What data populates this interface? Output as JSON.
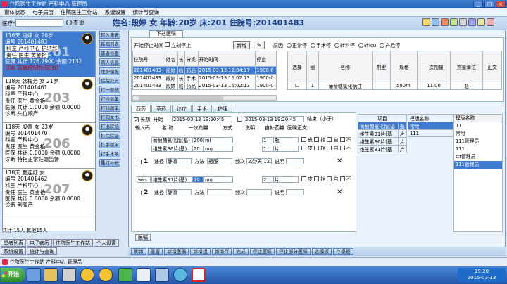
{
  "window": {
    "title": "住院医生工作站  产科中心  管理员"
  },
  "menu": [
    "窗体状态",
    "电子病历",
    "住院医生工作站",
    "系统设置",
    "统计与查询"
  ],
  "toolbar": {
    "card_label": "医疗卡",
    "query_label": "查询"
  },
  "patient_header": "姓名:段婷  女  年龄:20岁  床:201  住院号:201401483",
  "patients": [
    {
      "rows": [
        "116天  段婷   女  20岁",
        "编号  201401483",
        "科室  产科中心  护理部",
        "责任  医生  黄金艳",
        "医保  共计 176.7900 余额 2132",
        "诊断  疾病控制住院治疗"
      ],
      "bed": "201",
      "selected": true
    },
    {
      "rows": [
        "118天  张梅芳  女  21岁",
        "编号  201401461",
        "科室  产科中心",
        "责任  医生  黄金艳",
        "医保  共计 0.0000 余额 0.0000",
        "诊断  头位顺产"
      ],
      "bed": "203",
      "selected": false
    },
    {
      "rows": [
        "118天  殷佩  女  23岁",
        "编号  201401470",
        "科室  产科中心",
        "责任  医生  黄金艳",
        "医保  共计 0.0000 余额 0.0000",
        "诊断  特指正常妊娠监督"
      ],
      "bed": "206",
      "selected": false
    },
    {
      "rows": [
        "118天  夏连红  女",
        "编号  201401462",
        "科室  产科中心",
        "责任  医生  黄金艳",
        "医保  共计 0.0000 余额 0.0000",
        "诊断  剖腹产"
      ],
      "bed": "207",
      "selected": false
    }
  ],
  "left_status": "共计:15人  其他15人",
  "left_buttons": [
    "患者列表",
    "电子病历",
    "住院医生工作站",
    "个人设置",
    "系统设置",
    "统计与查询"
  ],
  "side_buttons": [
    "转入患者",
    "新病列表",
    "患者检查",
    "病人信息",
    "维护模板",
    "住院处方",
    "打一般核",
    "打检验单",
    "打钱超单",
    "打病文书",
    "打出院结",
    "打住院证",
    "打手续单",
    "打手术单",
    "重打补帐"
  ],
  "top_tab": "下达医嘱",
  "controls": {
    "stop_time_label": "开始停止时间",
    "immediate_stop_label": "立刻停止",
    "new_label": "新增",
    "edit_label": "✎"
  },
  "radios": [
    "原因",
    "正常停",
    "手术停",
    "转科停",
    "转icu",
    "产后停"
  ],
  "order_table": {
    "headers": [
      "住院号",
      "姓名",
      "长",
      "分类",
      "开始时间",
      "停止"
    ],
    "rows": [
      [
        "201401483",
        "段婷",
        "临",
        "药品",
        "2015-03-13 12:04:17",
        "1900-0"
      ],
      [
        "201401483",
        "段婷",
        "长",
        "手术",
        "2015-03-13 16:02:13",
        "1900-0"
      ],
      [
        "201401483",
        "段婷",
        "临",
        "药品",
        "2015-03-13 16:02:13",
        "1900-0"
      ]
    ]
  },
  "drug_table": {
    "headers": [
      "选择",
      "组",
      "名称",
      "剂型",
      "规格",
      "一次剂量",
      "剂量单位",
      "正文"
    ],
    "rows": [
      [
        "☐",
        "1",
        "葡萄糖氯化钠注",
        "",
        "500ml",
        "11.00",
        "瓶",
        ""
      ]
    ]
  },
  "tabs": [
    "西药",
    "草药",
    "诊疗",
    "手术",
    "护理"
  ],
  "entry": {
    "long_label": "长期",
    "start_label": "开始",
    "start_time": "2015-03-13 19:20:45",
    "end_time": "2015-03-13 19:20:45",
    "end_label": "结束（小于）",
    "col_headers": [
      "输入码",
      "名   称",
      "一次剂量",
      "方式",
      "说明",
      "自补药量",
      "医嘱正文"
    ],
    "group1": {
      "items": [
        {
          "name": "葡萄糖氯化钠(基)",
          "dose": "200",
          "unit": "ml",
          "qty": "1",
          "pack": "瓶"
        },
        {
          "name": "维生素B6片(基)",
          "dose": "20",
          "unit": "mg",
          "qty": "1",
          "pack": "片"
        }
      ],
      "num": "1",
      "route_label": "途径",
      "route": "静滴",
      "method_label": "方法",
      "method": "瓶服",
      "freq_label": "频次",
      "freq": "2次/天 12.",
      "desc_label": "说明"
    },
    "group2": {
      "code": "wss",
      "items": [
        {
          "name": "维生素B1片(基)",
          "dose": "10",
          "unit": "mg",
          "qty": "2",
          "pack": "片"
        }
      ],
      "num": "2",
      "route_label": "途径",
      "route": "静滴",
      "method_label": "方法",
      "freq_label": "频次",
      "desc_label": "说明"
    },
    "flags": [
      "皮",
      "抽",
      "自",
      "不"
    ]
  },
  "project_table": {
    "header": "项目",
    "rows": [
      "葡萄糖氯化钠(基",
      "维生素B1片(基",
      "维生素B6片(基",
      "维生素B1片(基"
    ],
    "units": [
      "瓶",
      "片",
      "片",
      "片"
    ]
  },
  "template_table": {
    "header": "模版名称",
    "rows": [
      "常用",
      "111"
    ]
  },
  "template2": {
    "header": "模版名称",
    "rows": [
      "11",
      "常用",
      "111管理员",
      "111",
      "ttt管理员",
      "111管理员"
    ]
  },
  "orders_tab": "医嘱",
  "bottom_buttons": [
    "刷新",
    "重置",
    "新增医嘱",
    "新增组",
    "新增行",
    "完成",
    "停止医嘱",
    "停止部分医嘱",
    "选模板",
    "存模板"
  ],
  "statusbar": "住院医生工作站  产科中心  管理员",
  "tray": {
    "time": "19:20",
    "date": "2015-03-13"
  },
  "start_label": "开始",
  "colors": {
    "selection": "#3d7ad0",
    "titlebar": "#2a62b5",
    "accent": "#173d86"
  }
}
